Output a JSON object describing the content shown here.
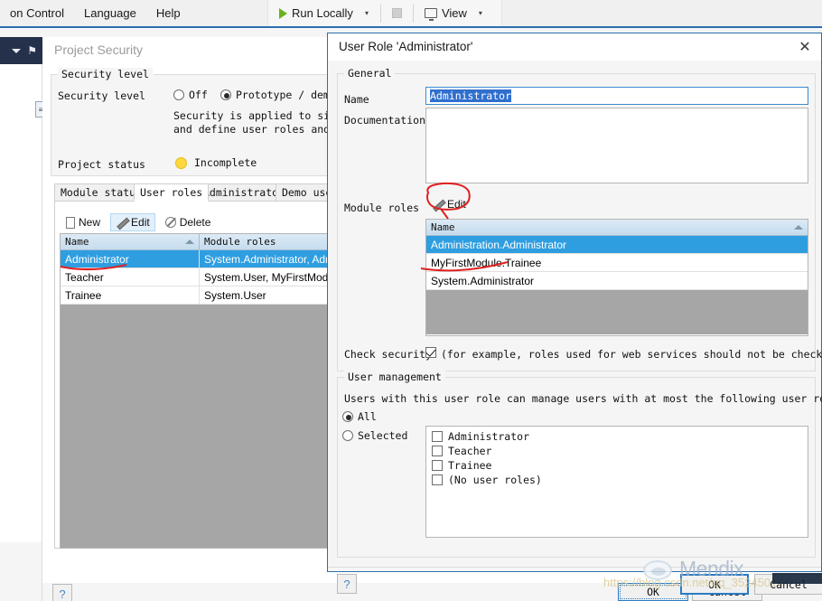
{
  "menubar": {
    "items": [
      {
        "label": "on Control",
        "name": "menu-version-control"
      },
      {
        "label": "Language",
        "name": "menu-language"
      },
      {
        "label": "Help",
        "name": "menu-help"
      }
    ]
  },
  "toolbar": {
    "run_label": "Run Locally",
    "run_chevron": "▾",
    "stop_icon": "stop-square-icon",
    "view_label": "View",
    "view_chevron": "▾"
  },
  "left_panel": {
    "caret_icon": "chevron-down-icon",
    "pin_icon": "⚑",
    "mini_tab_label": "≡"
  },
  "document": {
    "title": "Project Security",
    "security_group": {
      "legend": "Security level",
      "field_label": "Security level",
      "options": [
        {
          "label": "Off",
          "selected": false
        },
        {
          "label": "Prototype / demo",
          "selected": true
        }
      ],
      "description_line1": "Security is applied to signi",
      "description_line2": "and define user roles and se"
    },
    "project_status": {
      "label": "Project status",
      "value": "Incomplete",
      "dot_color": "#ffd83d"
    },
    "tabs": [
      {
        "label": "Module status",
        "active": false
      },
      {
        "label": "User roles",
        "active": true
      },
      {
        "label": "Administrator",
        "active": false
      },
      {
        "label": "Demo use",
        "active": false
      }
    ],
    "grid_toolbar": [
      {
        "label": "New",
        "icon": "page-icon",
        "selected": false
      },
      {
        "label": "Edit",
        "icon": "pencil-icon",
        "selected": true
      },
      {
        "label": "Delete",
        "icon": "ban-icon",
        "selected": false
      }
    ],
    "user_roles_grid": {
      "columns": [
        "Name",
        "Module roles"
      ],
      "rows": [
        {
          "name": "Administrator",
          "module_roles": "System.Administrator, Admi",
          "selected": true
        },
        {
          "name": "Teacher",
          "module_roles": "System.User, MyFirstModule",
          "selected": false
        },
        {
          "name": "Trainee",
          "module_roles": "System.User",
          "selected": false
        }
      ]
    },
    "help_label": "?"
  },
  "dialog": {
    "title": "User Role 'Administrator'",
    "close_icon": "✕",
    "general": {
      "legend": "General",
      "name_label": "Name",
      "name_value": "Administrator",
      "documentation_label": "Documentation",
      "documentation_value": "",
      "module_roles_label": "Module roles",
      "edit_button_label": "Edit",
      "edit_button_icon": "pencil-icon",
      "module_roles_grid": {
        "columns": [
          "Name"
        ],
        "rows": [
          {
            "name": "Administration.Administrator",
            "selected": true
          },
          {
            "name": "MyFirstModule.Trainee",
            "selected": false
          },
          {
            "name": "System.Administrator",
            "selected": false
          }
        ]
      },
      "check_security_label": "Check security",
      "check_security_checked": true,
      "check_security_note": "(for example, roles used for web services should not be checked for se"
    },
    "user_management": {
      "legend": "User management",
      "description": "Users with this user role can manage users with at most the following user roles.",
      "all_label": "All",
      "all_selected": true,
      "selected_label": "Selected",
      "selected_selected": false,
      "checkbox_items": [
        {
          "label": "Administrator",
          "checked": false
        },
        {
          "label": "Teacher",
          "checked": false
        },
        {
          "label": "Trainee",
          "checked": false
        },
        {
          "label": "(No user roles)",
          "checked": false
        }
      ]
    },
    "footer": {
      "help_label": "?",
      "ok_label": "OK",
      "cancel_label": "Cancel"
    }
  },
  "background_dialog_footer": {
    "ok_label": "OK",
    "cancel_label": "Cancel"
  },
  "watermark": {
    "brand": "Mendix",
    "url": "https://blog.csdn.net/qq_35245017"
  },
  "colors": {
    "accent": "#2b6fb0",
    "selection": "#2f9ee0",
    "annotation": "#e02020",
    "status_incomplete": "#ffd83d",
    "run_green": "#68b31e"
  }
}
